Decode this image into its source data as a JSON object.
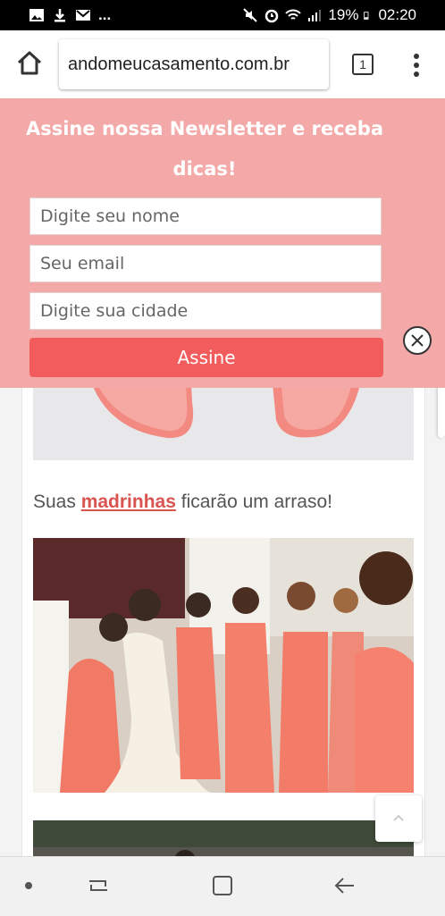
{
  "status_bar": {
    "battery": "19%",
    "time": "02:20",
    "overflow": "..."
  },
  "browser": {
    "url": "andomeucasamento.com.br",
    "tab_count": "1"
  },
  "newsletter": {
    "title": "Assine nossa Newsletter e receba dicas!",
    "name_placeholder": "Digite seu nome",
    "email_placeholder": "Seu email",
    "city_placeholder": "Digite sua cidade",
    "submit_label": "Assine"
  },
  "article": {
    "caption_prefix": "Suas ",
    "caption_link": "madrinhas",
    "caption_suffix": " ficarão um arraso!"
  },
  "colors": {
    "popup_bg": "#f4a9a9",
    "button_bg": "#f25c5c",
    "link": "#d9534f"
  }
}
